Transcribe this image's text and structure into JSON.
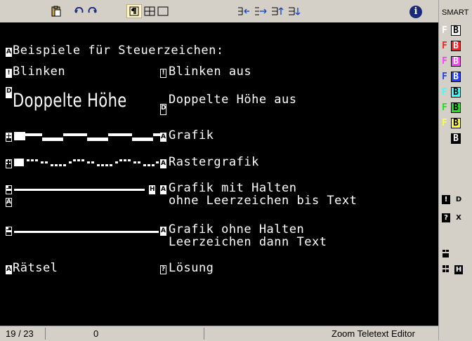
{
  "toolbar": {
    "paste_icon": "clipboard-icon",
    "undo_icon": "undo-icon",
    "redo_icon": "redo-icon",
    "para_icon": "pilcrow",
    "grid_icon": "grid",
    "box_icon": "box",
    "info_label": "i"
  },
  "editor": {
    "line_heading": "Beispiele für Steuerzeichen:",
    "blink_label": "Blinken",
    "blink_off_label": "Blinken aus",
    "double_label": "Doppelte Höhe",
    "double_off_label": "Doppelte Höhe aus",
    "grafik_label": "Grafik",
    "raster_label": "Rastergrafik",
    "hold_label_1": "Grafik mit Halten",
    "hold_label_2": "ohne Leerzeichen bis Text",
    "nohold_label_1": "Grafik ohne Halten",
    "nohold_label_2": "Leerzeichen dann Text",
    "riddle_label": "Rätsel",
    "solution_label": "Lösung",
    "ctl_a": "A",
    "ctl_blink": "!",
    "ctl_d": "D",
    "ctl_h": "H",
    "ctl_q": "?"
  },
  "status": {
    "position": "19 / 23",
    "column": "0",
    "app_name": "Zoom Teletext Editor"
  },
  "panel": {
    "title": "SMART",
    "rows": [
      {
        "f": "F",
        "b": "B",
        "fg": "#ffffff",
        "bg": "#ffffff",
        "bcolor": "#000000"
      },
      {
        "f": "F",
        "b": "B",
        "fg": "#ff2020",
        "bg": "#ff2020",
        "bcolor": "#ffffff"
      },
      {
        "f": "F",
        "b": "B",
        "fg": "#ff40ff",
        "bg": "#ff40ff",
        "bcolor": "#ffffff"
      },
      {
        "f": "F",
        "b": "B",
        "fg": "#2040ff",
        "bg": "#2040ff",
        "bcolor": "#ffffff"
      },
      {
        "f": "F",
        "b": "B",
        "fg": "#40ffff",
        "bg": "#40ffff",
        "bcolor": "#000000"
      },
      {
        "f": "F",
        "b": "B",
        "fg": "#20e020",
        "bg": "#20e020",
        "bcolor": "#000000"
      },
      {
        "f": "F",
        "b": "B",
        "fg": "#ffff40",
        "bg": "#ffff40",
        "bcolor": "#000000"
      },
      {
        "f": "",
        "b": "B",
        "fg": "#000000",
        "bg": "#000000",
        "bcolor": "#ffffff"
      }
    ],
    "sym_blink": "!",
    "sym_d": "D",
    "sym_q": "?",
    "sym_x": "X",
    "sym_grid": "#",
    "sym_h": "H"
  }
}
